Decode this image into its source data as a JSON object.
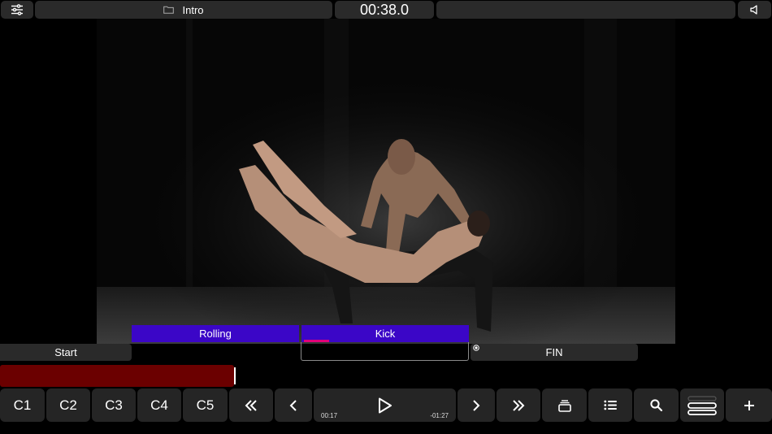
{
  "top_bar": {
    "title": "Intro",
    "timecode": "00:38.0",
    "icons": [
      "sliders-icon",
      "folder-icon",
      "speaker-icon"
    ]
  },
  "cues": {
    "rolling": "Rolling",
    "kick": "Kick",
    "kick_progress": 0.15
  },
  "markers": {
    "start": "Start",
    "fin": "FIN"
  },
  "playback": {
    "progress": 0.303,
    "elapsed": "00:17",
    "remaining": "-01:27"
  },
  "controls": {
    "c1": "C1",
    "c2": "C2",
    "c3": "C3",
    "c4": "C4",
    "c5": "C5",
    "icons": [
      "rewind-double-icon",
      "chevron-left-icon",
      "play-icon",
      "chevron-right-icon",
      "fast-forward-double-icon",
      "layers-icon",
      "list-icon",
      "search-icon",
      "tracks-icon",
      "plus-icon"
    ]
  },
  "colors": {
    "cue": "#3b06c7",
    "progress": "#6b0000",
    "accent": "#e2007a",
    "panel": "#2a2a2a"
  }
}
